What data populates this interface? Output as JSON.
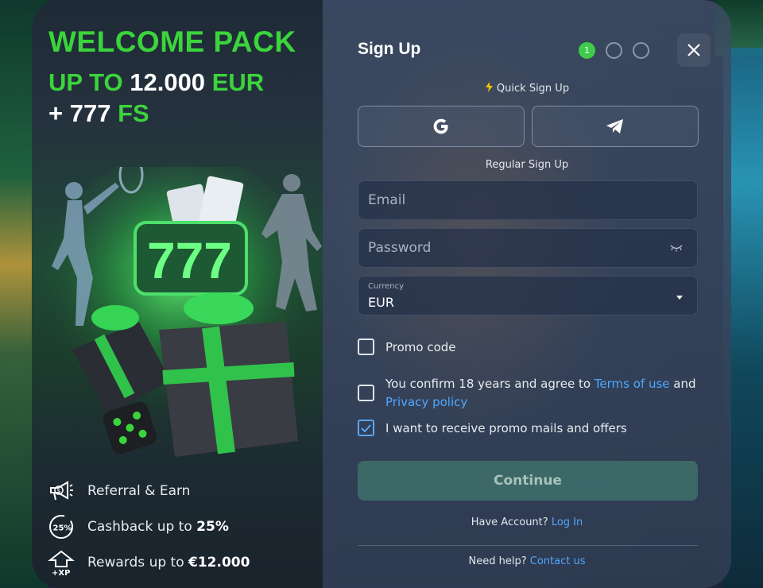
{
  "promo": {
    "title": "WELCOME PACK",
    "line2_prefix": "UP TO",
    "line2_amount": "12.000",
    "line2_currency": "EUR",
    "line3_prefix": "+",
    "line3_amount": "777",
    "line3_suffix": "FS",
    "perks": [
      {
        "icon": "megaphone-icon",
        "text": "Referral & Earn",
        "bold": ""
      },
      {
        "icon": "cashback-25-icon",
        "text": "Cashback up to ",
        "bold": "25%"
      },
      {
        "icon": "xp-rank-icon",
        "text": "Rewards up to ",
        "bold": "€12.000"
      }
    ]
  },
  "form": {
    "title": "Sign Up",
    "steps": [
      "1",
      "",
      ""
    ],
    "quick_label": "Quick Sign Up",
    "regular_label": "Regular Sign Up",
    "email_placeholder": "Email",
    "password_placeholder": "Password",
    "currency_label": "Currency",
    "currency_value": "EUR",
    "promo_label": "Promo code",
    "terms_text_1": "You confirm 18 years and agree to ",
    "terms_link": "Terms of use",
    "terms_text_2": " and",
    "privacy_link": "Privacy policy",
    "mails_label": "I want to receive promo mails and offers",
    "continue_label": "Continue",
    "have_account": "Have Account?",
    "login_link": "Log In",
    "need_help": "Need help?",
    "contact_link": "Contact us"
  },
  "colors": {
    "accent_green": "#3bd43b",
    "link_blue": "#4fa8ff",
    "step_active": "#3fcc4a"
  }
}
